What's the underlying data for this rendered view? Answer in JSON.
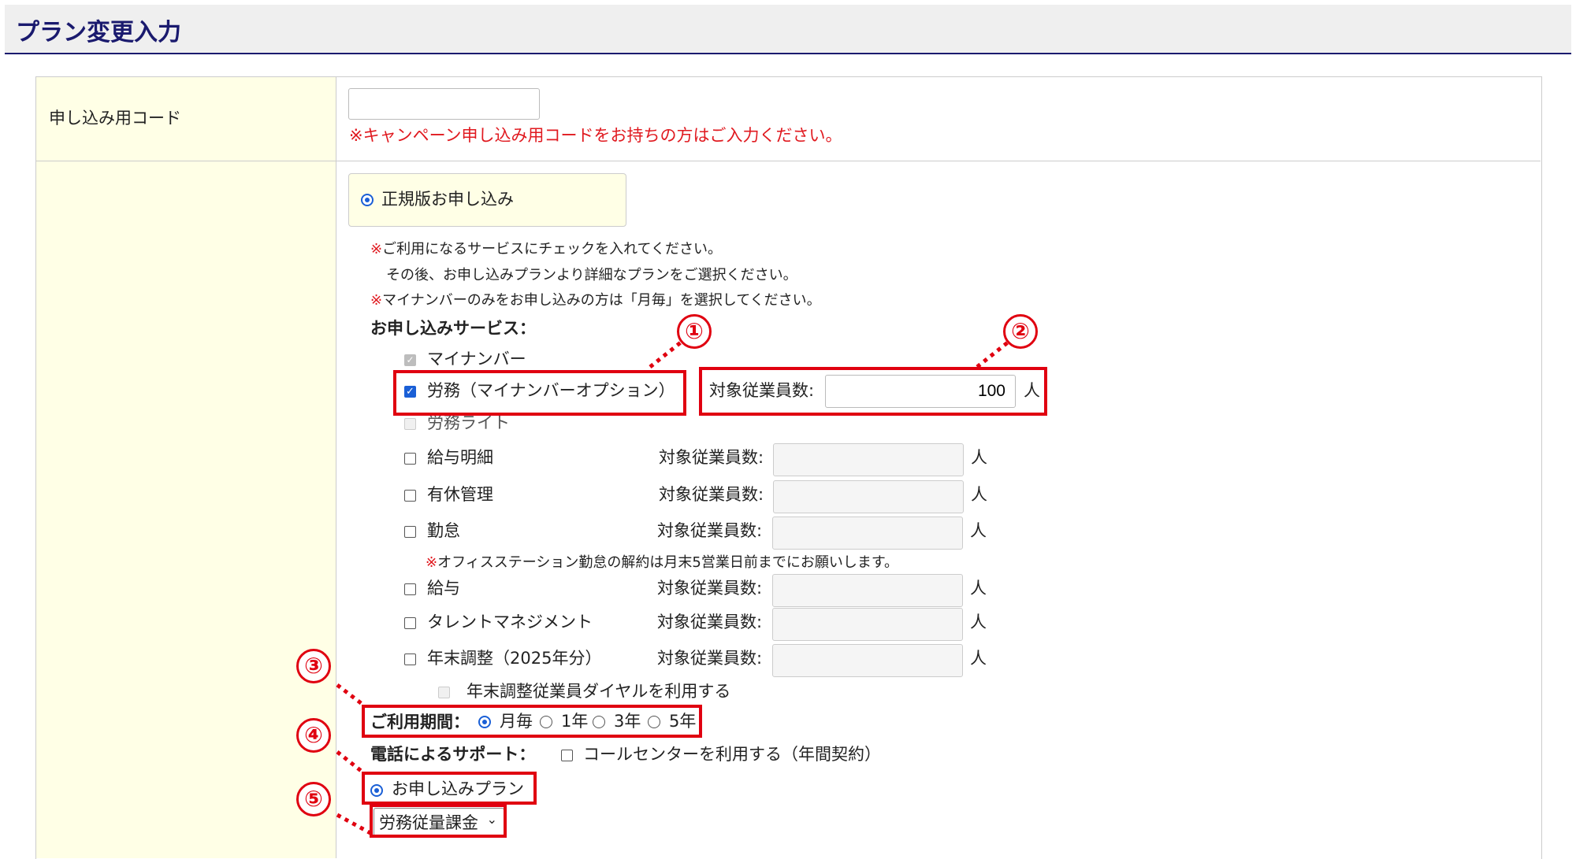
{
  "page_title": "プラン変更入力",
  "campaign": {
    "label": "申し込み用コード",
    "value": "",
    "note": "※キャンペーン申し込み用コードをお持ちの方はご入力ください。"
  },
  "plan_option": {
    "label": "正規版お申し込み"
  },
  "notes": {
    "mark": "※",
    "line1": "ご利用になるサービスにチェックを入れてください。",
    "line2": "その後、お申し込みプランより詳細なプランをご選択ください。",
    "line3": "マイナンバーのみをお申し込みの方は「月毎」を選択してください。"
  },
  "services_label": "お申し込みサービス：",
  "employee_label": "対象従業員数:",
  "unit": "人",
  "services": {
    "mynumber": {
      "label": "マイナンバー",
      "checked": true,
      "disabled": true
    },
    "labor": {
      "label": "労務（マイナンバーオプション）",
      "checked": true,
      "employees": "100"
    },
    "labor_lite": {
      "label": "労務ライト",
      "checked": false,
      "disabled": true
    },
    "payslip": {
      "label": "給与明細",
      "checked": false,
      "employees": ""
    },
    "leave": {
      "label": "有休管理",
      "checked": false,
      "employees": ""
    },
    "attendance": {
      "label": "勤怠",
      "checked": false,
      "employees": ""
    },
    "payroll": {
      "label": "給与",
      "checked": false,
      "employees": ""
    },
    "talent": {
      "label": "タレントマネジメント",
      "checked": false,
      "employees": ""
    },
    "year_end": {
      "label": "年末調整（2025年分）",
      "checked": false,
      "employees": ""
    },
    "year_end_dial": {
      "label": "年末調整従業員ダイヤルを利用する",
      "checked": false,
      "disabled": true
    }
  },
  "attendance_note": "オフィスステーション勤怠の解約は月末5営業日前までにお願いします。",
  "period": {
    "label": "ご利用期間：",
    "options": [
      "月毎",
      "1年",
      "3年",
      "5年"
    ],
    "selected": "月毎"
  },
  "support": {
    "label": "電話によるサポート：",
    "option": "コールセンターを利用する（年間契約）"
  },
  "apply_plan": {
    "label": "お申し込みプラン"
  },
  "plan_select": {
    "value": "労務従量課金"
  },
  "callouts": [
    "①",
    "②",
    "③",
    "④",
    "⑤"
  ],
  "colors": {
    "accent": "#1a1a6e",
    "highlight": "#e00010",
    "label_bg": "#ffffe6",
    "radio": "#1a5fd6"
  }
}
